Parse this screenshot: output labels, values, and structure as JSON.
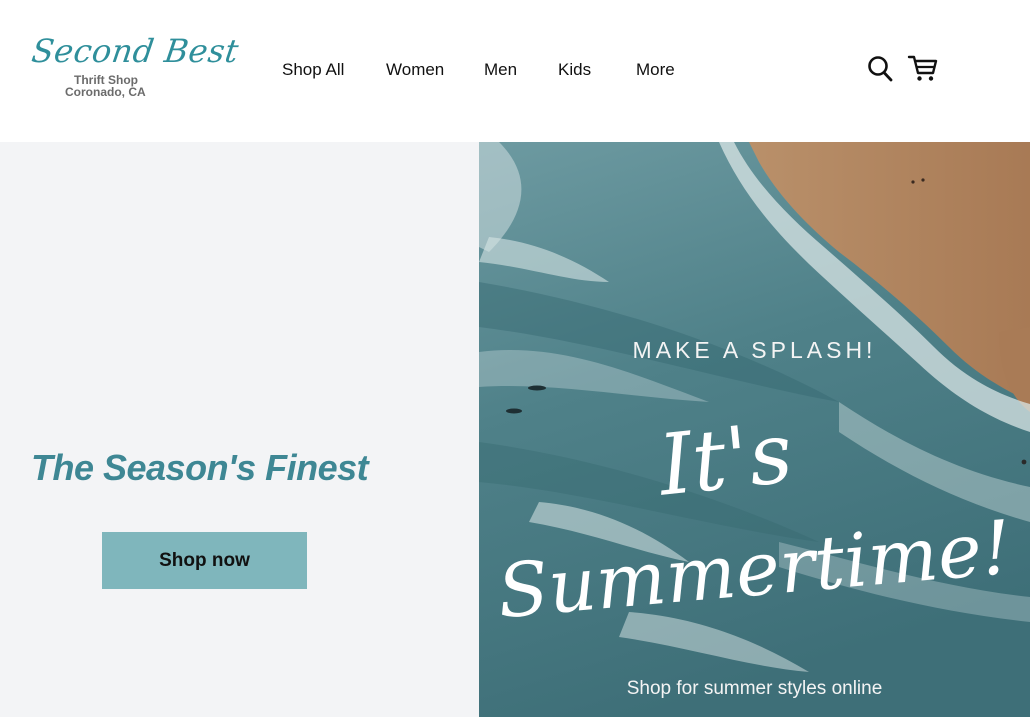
{
  "brand": {
    "script_name": "Second Best",
    "line1": "Thrift Shop",
    "line2": "Coronado, CA",
    "color": "#2f8f9b"
  },
  "nav": {
    "items": [
      "Shop All",
      "Women",
      "Men",
      "Kids",
      "More"
    ]
  },
  "icons": {
    "search": "search-icon",
    "cart": "cart-icon"
  },
  "hero": {
    "title": "The Season's Finest",
    "title_color": "#3e8794",
    "cta_label": "Shop now",
    "cta_color": "#7fb6bc",
    "panel_bg": "#f3f4f6"
  },
  "banner": {
    "kicker": "MAKE A SPLASH!",
    "headline_line1": "It's",
    "headline_line2": "Summertime!",
    "footer": "Shop for summer styles online"
  }
}
